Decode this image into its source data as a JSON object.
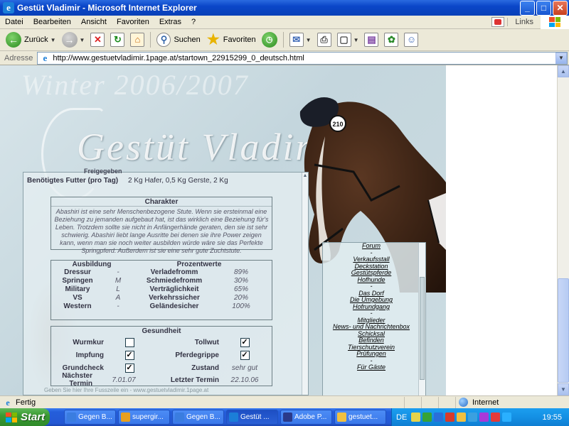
{
  "window": {
    "title": "Gestüt Vladimir - Microsoft Internet Explorer",
    "buttons": {
      "minimize": "_",
      "maximize": "□",
      "close": "✕"
    }
  },
  "menu": {
    "items": [
      "Datei",
      "Bearbeiten",
      "Ansicht",
      "Favoriten",
      "Extras",
      "?"
    ],
    "links_label": "Links"
  },
  "toolbar": {
    "back_label": "Zurück",
    "search_label": "Suchen",
    "favorites_label": "Favoriten"
  },
  "address": {
    "label": "Adresse",
    "url": "http://www.gestuetvladimir.1page.at/startown_22915299_0_deutsch.html"
  },
  "site": {
    "watermark": "Winter 2006/2007",
    "logo": "Gestüt Vladimir",
    "cutoff_label": "Freigegeben",
    "futter": {
      "key": "Benötigtes Futter (pro Tag)",
      "value": "2 Kg Hafer, 0,5 Kg Gerste, 2 Kg"
    },
    "charakter": {
      "title": "Charakter",
      "text": "Abashiri ist eine sehr Menschenbezogene Stute. Wenn sie ersteinmal eine Beziehung zu jemanden aufgebaut hat, ist das wirklich eine Beziehung für's Leben. Trotzdem sollte sie nicht in Anfängerhände geraten, den sie ist sehr schwierig. Abashiri liebt lange Ausritte bei denen sie ihre Power zeigen kann, wenn man sie noch weiter ausbilden würde wäre sie das Perfekte Springpferd. Außerdem ist sie eine sehr gute Zuchtstute."
    },
    "ausbildung": {
      "header_left": "Ausbildung",
      "header_right": "Prozentwerte",
      "rows": [
        {
          "a": "Dressur",
          "b": "-",
          "c": "Verladefromm",
          "d": "89%"
        },
        {
          "a": "Springen",
          "b": "M",
          "c": "Schmiedefromm",
          "d": "30%"
        },
        {
          "a": "Military",
          "b": "L",
          "c": "Verträglichkeit",
          "d": "65%"
        },
        {
          "a": "VS",
          "b": "A",
          "c": "Verkehrssicher",
          "d": "20%"
        },
        {
          "a": "Western",
          "b": "-",
          "c": "Geländesicher",
          "d": "100%"
        }
      ]
    },
    "gesundheit": {
      "title": "Gesundheit",
      "wurmkur": "Wurmkur",
      "tollwut": "Tollwut",
      "impfung": "Impfung",
      "pferdegrippe": "Pferdegrippe",
      "grundcheck": "Grundcheck",
      "zustand": "Zustand",
      "zustand_value": "sehr gut",
      "naechster_termin": "Nächster Termin",
      "naechster_termin_value": "7.01.07",
      "letzter_termin": "Letzter Termin",
      "letzter_termin_value": "22.10.06",
      "checks": {
        "wurmkur": false,
        "tollwut": true,
        "impfung": true,
        "pferdegrippe": true,
        "grundcheck": true
      }
    },
    "footer": "Geben Sie hier Ihre Fusszeile ein - www.gestuetvladimir.1page.at"
  },
  "nav": [
    {
      "type": "item",
      "label": "Forum"
    },
    {
      "type": "sep",
      "label": "-"
    },
    {
      "type": "item",
      "label": "Verkaufsstall"
    },
    {
      "type": "item",
      "label": "Deckstation"
    },
    {
      "type": "item",
      "label": "Gestütspferde"
    },
    {
      "type": "item",
      "label": "Hofhunde"
    },
    {
      "type": "sep",
      "label": "-"
    },
    {
      "type": "item",
      "label": "Das Dorf"
    },
    {
      "type": "item",
      "label": "Die Umgebung"
    },
    {
      "type": "item",
      "label": "Hofrundgang"
    },
    {
      "type": "sep",
      "label": "-"
    },
    {
      "type": "item",
      "label": "Mitglieder"
    },
    {
      "type": "item",
      "label": "News- und Nachrichtenbox"
    },
    {
      "type": "item",
      "label": "Schicksal"
    },
    {
      "type": "item",
      "label": "Befinden"
    },
    {
      "type": "item",
      "label": "Tierschutzverein"
    },
    {
      "type": "item",
      "label": "Prüfungen"
    },
    {
      "type": "sep",
      "label": "-"
    },
    {
      "type": "item",
      "label": "Für Gäste"
    }
  ],
  "status": {
    "text": "Fertig",
    "zone": "Internet"
  },
  "taskbar": {
    "start_label": "Start",
    "tasks": [
      {
        "label": "Gegen B...",
        "color": "#3a7de0",
        "active": false
      },
      {
        "label": "supergir...",
        "color": "#e8a020",
        "active": false
      },
      {
        "label": "Gegen B...",
        "color": "#3a7de0",
        "active": false
      },
      {
        "label": "Gestüt ...",
        "color": "#1b7ed8",
        "active": true
      },
      {
        "label": "Adobe P...",
        "color": "#2a3a8a",
        "active": false
      },
      {
        "label": "gestuet...",
        "color": "#f0c040",
        "active": false
      }
    ],
    "language": "DE",
    "clock": "19:55"
  }
}
